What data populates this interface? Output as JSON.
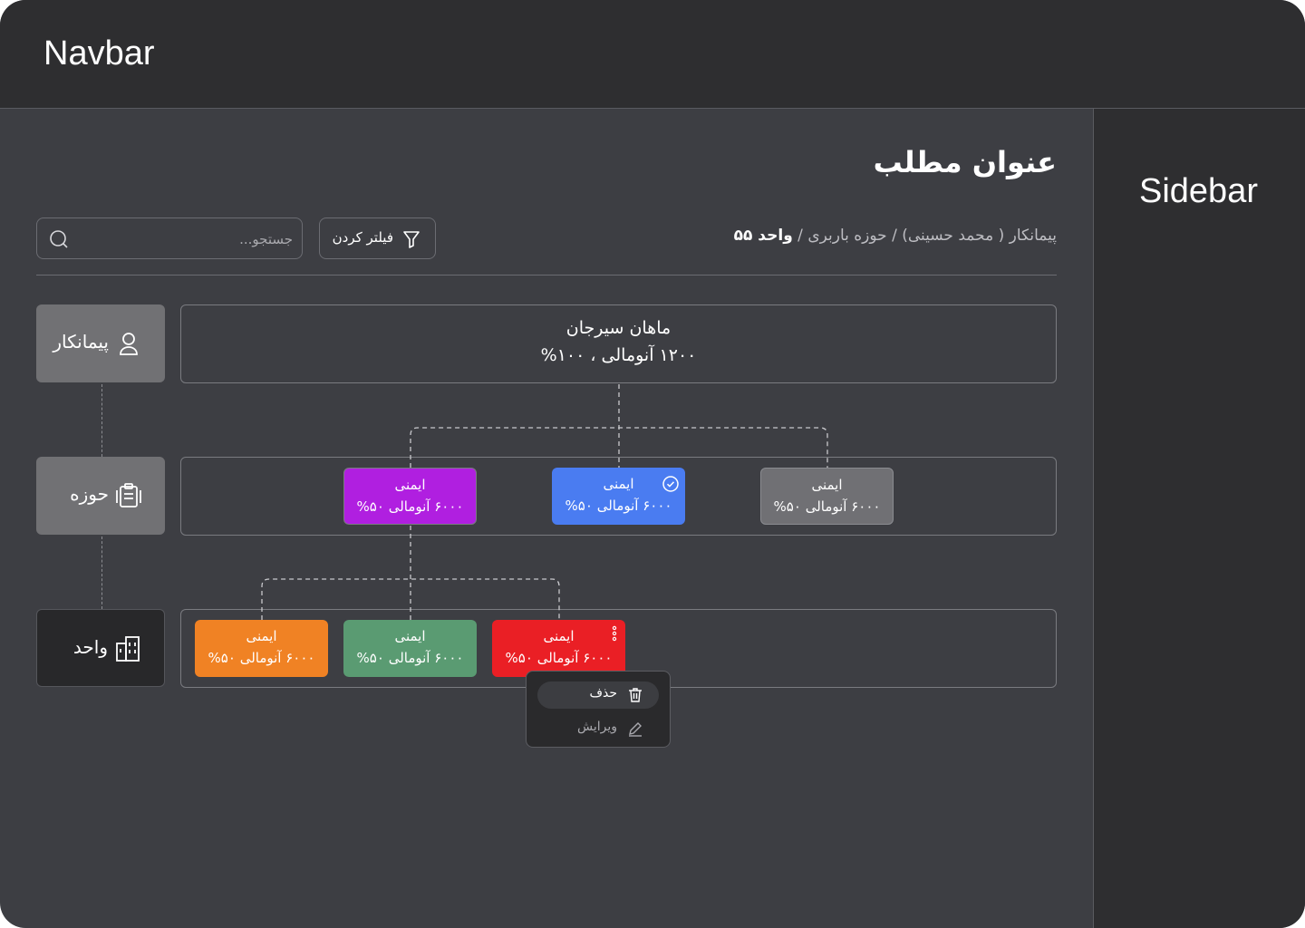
{
  "navbar": {
    "title": "Navbar"
  },
  "sidebar": {
    "title": "Sidebar"
  },
  "page": {
    "title": "عنوان مطلب"
  },
  "breadcrumb": {
    "path": "پیمانکار ( محمد حسینی) / حوزه باربری / ",
    "current": "واحد ۵۵"
  },
  "toolbar": {
    "filter_label": "فیلتر کردن",
    "search_placeholder": "جستجو..."
  },
  "levels": [
    {
      "label": "پیمانکار",
      "icon": "user-icon"
    },
    {
      "label": "حوزه",
      "icon": "clipboard-icon"
    },
    {
      "label": "واحد",
      "icon": "building-icon"
    }
  ],
  "root": {
    "name": "ماهان سیرجان",
    "value": "۱۲۰۰ آنومالی ، ۱۰۰%"
  },
  "domains": [
    {
      "label": "ایمنی",
      "value": "۶۰۰۰ آنومالی ۵۰%",
      "color": "#b01fe0"
    },
    {
      "label": "ایمنی",
      "value": "۶۰۰۰ آنومالی ۵۰%",
      "color": "#4a7cf1",
      "selected": true
    },
    {
      "label": "ایمنی",
      "value": "۶۰۰۰ آنومالی ۵۰%",
      "color": "#707074"
    }
  ],
  "units": [
    {
      "label": "ایمنی",
      "value": "۶۰۰۰ آنومالی ۵۰%",
      "color": "#f08224"
    },
    {
      "label": "ایمنی",
      "value": "۶۰۰۰ آنومالی ۵۰%",
      "color": "#5a9b72"
    },
    {
      "label": "ایمنی",
      "value": "۶۰۰۰ آنومالی ۵۰%",
      "color": "#ea1f25"
    }
  ],
  "context_menu": {
    "delete_label": "حذف",
    "edit_label": "ویرایش"
  }
}
